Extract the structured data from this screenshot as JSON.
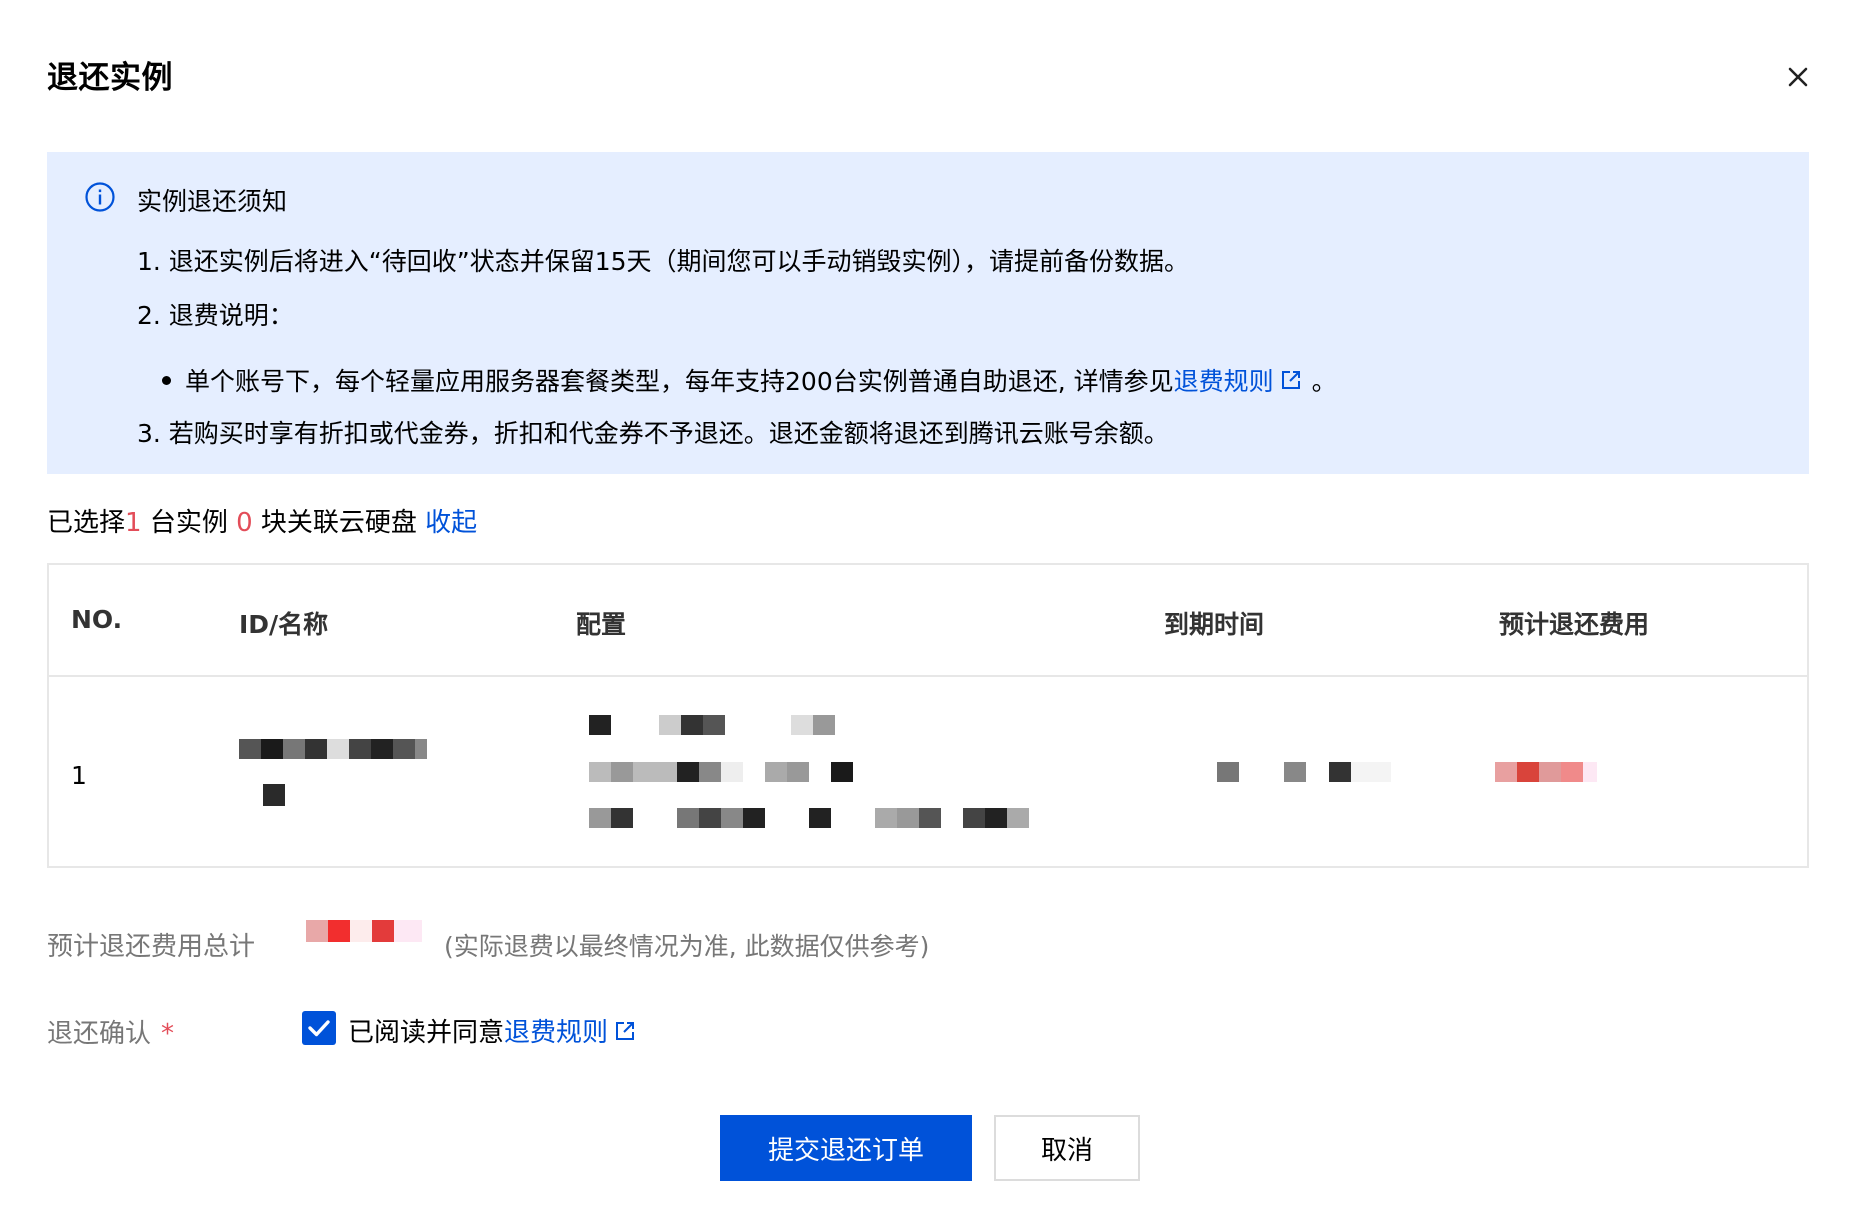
{
  "dialog": {
    "title": "退还实例",
    "close_icon": "close-icon"
  },
  "notice": {
    "icon": "info-circle-icon",
    "title": "实例退还须知",
    "line1": "1. 退还实例后将进入“待回收”状态并保留15天（期间您可以手动销毁实例），请提前备份数据。",
    "line2": "2. 退费说明：",
    "bullet_text": "单个账号下，每个轻量应用服务器套餐类型，每年支持200台实例普通自助退还, 详情参见",
    "bullet_link": "退费规则",
    "bullet_suffix": "。",
    "line3": "3. 若购买时享有折扣或代金券，折扣和代金券不予退还。退还金额将退还到腾讯云账号余额。"
  },
  "selection": {
    "prefix": "已选择",
    "instance_count": "1",
    "instance_suffix": " 台实例 ",
    "disk_count": "0",
    "disk_suffix": " 块关联云硬盘 ",
    "collapse_link": "收起"
  },
  "table": {
    "headers": {
      "no": "NO.",
      "id_name": "ID/名称",
      "config": "配置",
      "expiry": "到期时间",
      "refund": "预计退还费用"
    },
    "rows": [
      {
        "no": "1"
      }
    ]
  },
  "form": {
    "total_label": "预计退还费用总计",
    "total_hint": "(实际退费以最终情况为准, 此数据仅供参考)",
    "confirm_label": "退还确认",
    "required_mark": "*",
    "agree_text": "已阅读并同意",
    "agree_link": "退费规则",
    "agree_checked": true
  },
  "buttons": {
    "submit": "提交退还订单",
    "cancel": "取消"
  },
  "colors": {
    "primary": "#0052d9",
    "notice_bg": "#e5eeff",
    "danger": "#e34d59"
  }
}
